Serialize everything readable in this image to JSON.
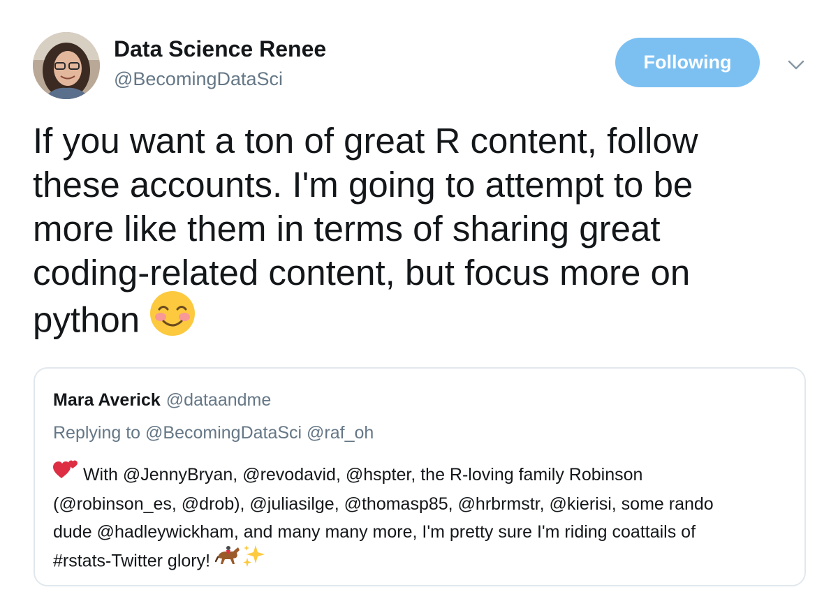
{
  "tweet": {
    "author_name": "Data Science Renee",
    "author_handle": "@BecomingDataSci",
    "follow_button_label": "Following",
    "text_lines": [
      "If you want a ton of great R content, follow",
      "these accounts. I'm going to attempt to be",
      "more like them in terms of sharing great",
      "coding-related content, but focus more on",
      "python"
    ],
    "emoji": "smiling-face-with-blushing-cheeks-icon"
  },
  "quoted_tweet": {
    "author_name": "Mara Averick",
    "author_handle": "@dataandme",
    "replying_to": "Replying to @BecomingDataSci @raf_oh",
    "body_lines": [
      "With @JennyBryan, @revodavid, @hspter, the R-loving family Robinson",
      "(@robinson_es, @drob), @juliasilge, @thomasp85, @hrbrmstr, @kierisi, some rando",
      "dude @hadleywickham, and many many more, I'm pretty sure I'm riding coattails of",
      "#rstats-Twitter glory!"
    ],
    "emojis": [
      "two-hearts-icon",
      "horse-racing-icon",
      "sparkles-icon"
    ]
  },
  "colors": {
    "follow_button": "#7cc0f2",
    "secondary_text": "#657786",
    "card_border": "#e1e8ed"
  }
}
